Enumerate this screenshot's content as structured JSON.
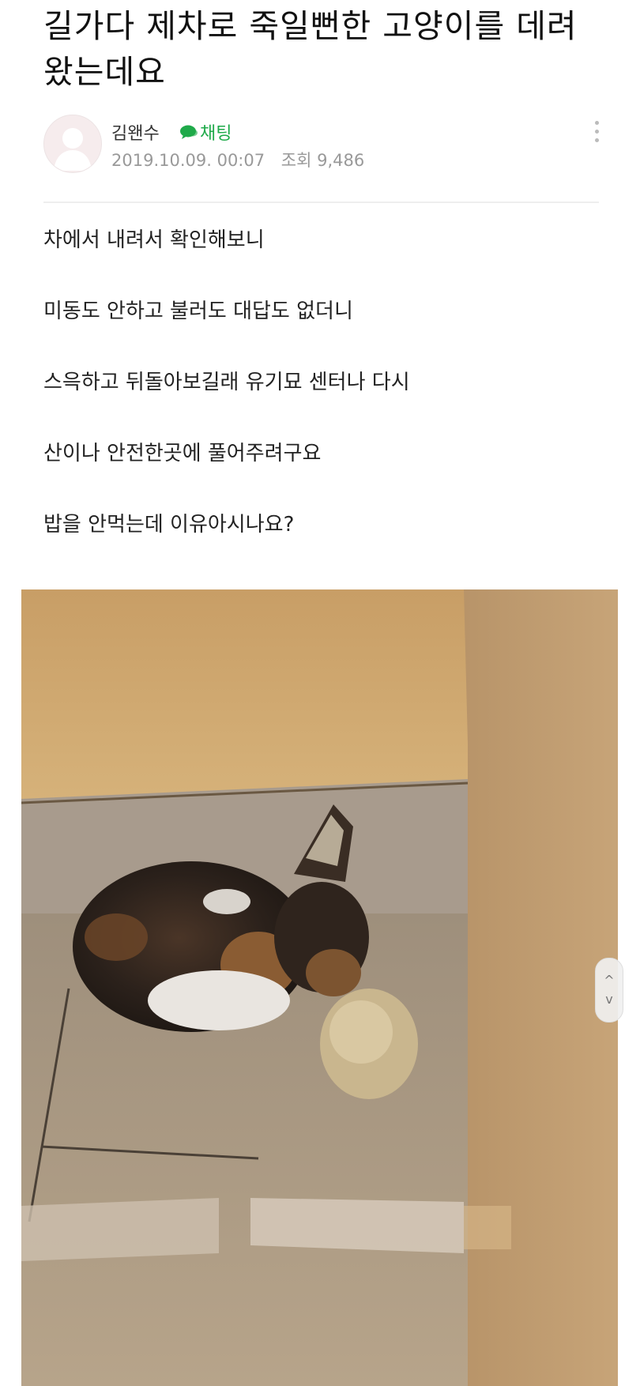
{
  "post": {
    "title": "길가다 제차로 죽일뻔한 고양이를 데려 왔는데요",
    "author": {
      "name": "김왠수",
      "chat_label": "채팅"
    },
    "date": "2019.10.09. 00:07",
    "views_label": "조회",
    "views_value": "9,486",
    "body": [
      "차에서 내려서 확인해보니",
      "미동도 안하고 불러도 대답도 없더니",
      "스윽하고 뒤돌아보길래 유기묘 센터나 다시",
      "산이나 안전한곳에 풀어주려구요",
      "밥을 안먹는데 이유아시나요?"
    ]
  },
  "icons": {
    "avatar": "user-placeholder-icon",
    "chat": "chat-bubble-icon",
    "more": "more-vertical-icon",
    "scroll_up": "chevron-up-icon",
    "scroll_down": "chevron-down-icon"
  },
  "scroll": {
    "up_glyph": "^",
    "down_glyph": "v"
  },
  "colors": {
    "chat_accent": "#1faa4a",
    "meta_text": "#999999",
    "divider": "#eeeeee"
  }
}
